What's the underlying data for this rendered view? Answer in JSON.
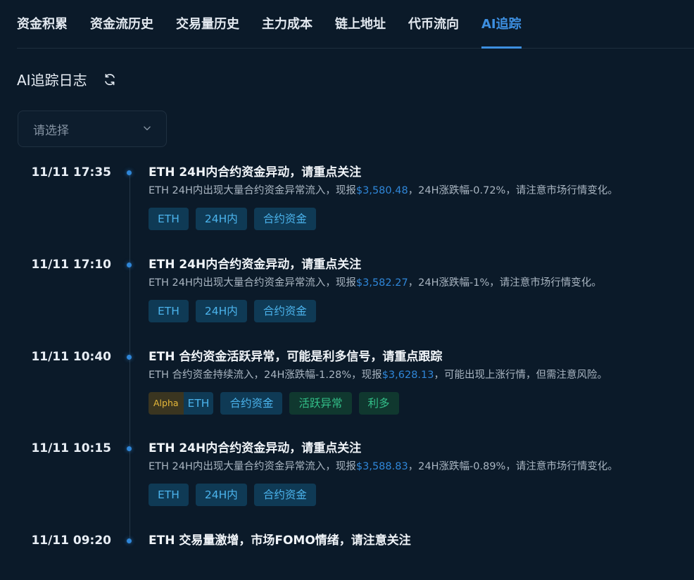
{
  "tabs": [
    {
      "label": "资金积累"
    },
    {
      "label": "资金流历史"
    },
    {
      "label": "交易量历史"
    },
    {
      "label": "主力成本"
    },
    {
      "label": "链上地址"
    },
    {
      "label": "代币流向"
    },
    {
      "label": "AI追踪",
      "active": true
    }
  ],
  "log_title": "AI追踪日志",
  "select": {
    "placeholder": "请选择"
  },
  "colors": {
    "accent": "#3d8fe0",
    "price": "#2f86d8",
    "tag_blue": "#4bb3ec",
    "tag_green": "#33c08a",
    "alpha": "#e6b93a"
  },
  "entries": [
    {
      "time": "11/11 17:35",
      "title": "ETH 24H内合约资金异动，请重点关注",
      "desc_before": "ETH 24H内出现大量合约资金异常流入，现报",
      "price": "$3,580.48",
      "desc_after": "，24H涨跌幅-0.72%，请注意市场行情变化。",
      "tags": [
        {
          "label": "ETH",
          "style": "blue"
        },
        {
          "label": "24H内",
          "style": "blue"
        },
        {
          "label": "合约资金",
          "style": "blue"
        }
      ]
    },
    {
      "time": "11/11 17:10",
      "title": "ETH 24H内合约资金异动，请重点关注",
      "desc_before": "ETH 24H内出现大量合约资金异常流入，现报",
      "price": "$3,582.27",
      "desc_after": "，24H涨跌幅-1%，请注意市场行情变化。",
      "tags": [
        {
          "label": "ETH",
          "style": "blue"
        },
        {
          "label": "24H内",
          "style": "blue"
        },
        {
          "label": "合约资金",
          "style": "blue"
        }
      ]
    },
    {
      "time": "11/11 10:40",
      "title": "ETH 合约资金活跃异常，可能是利多信号，请重点跟踪",
      "desc_before": "ETH 合约资金持续流入，24H涨跌幅-1.28%，现报",
      "price": "$3,628.13",
      "desc_after": "，可能出现上涨行情，但需注意风险。",
      "badge": "Alpha",
      "tags": [
        {
          "label": "ETH",
          "style": "blue",
          "joined": true
        },
        {
          "label": "合约资金",
          "style": "blue"
        },
        {
          "label": "活跃异常",
          "style": "green"
        },
        {
          "label": "利多",
          "style": "green"
        }
      ]
    },
    {
      "time": "11/11 10:15",
      "title": "ETH 24H内合约资金异动，请重点关注",
      "desc_before": "ETH 24H内出现大量合约资金异常流入，现报",
      "price": "$3,588.83",
      "desc_after": "，24H涨跌幅-0.89%，请注意市场行情变化。",
      "tags": [
        {
          "label": "ETH",
          "style": "blue"
        },
        {
          "label": "24H内",
          "style": "blue"
        },
        {
          "label": "合约资金",
          "style": "blue"
        }
      ]
    },
    {
      "time": "11/11 09:20",
      "title": "ETH 交易量激增，市场FOMO情绪，请注意关注",
      "desc_before": "",
      "price": "",
      "desc_after": "",
      "tags": []
    }
  ]
}
